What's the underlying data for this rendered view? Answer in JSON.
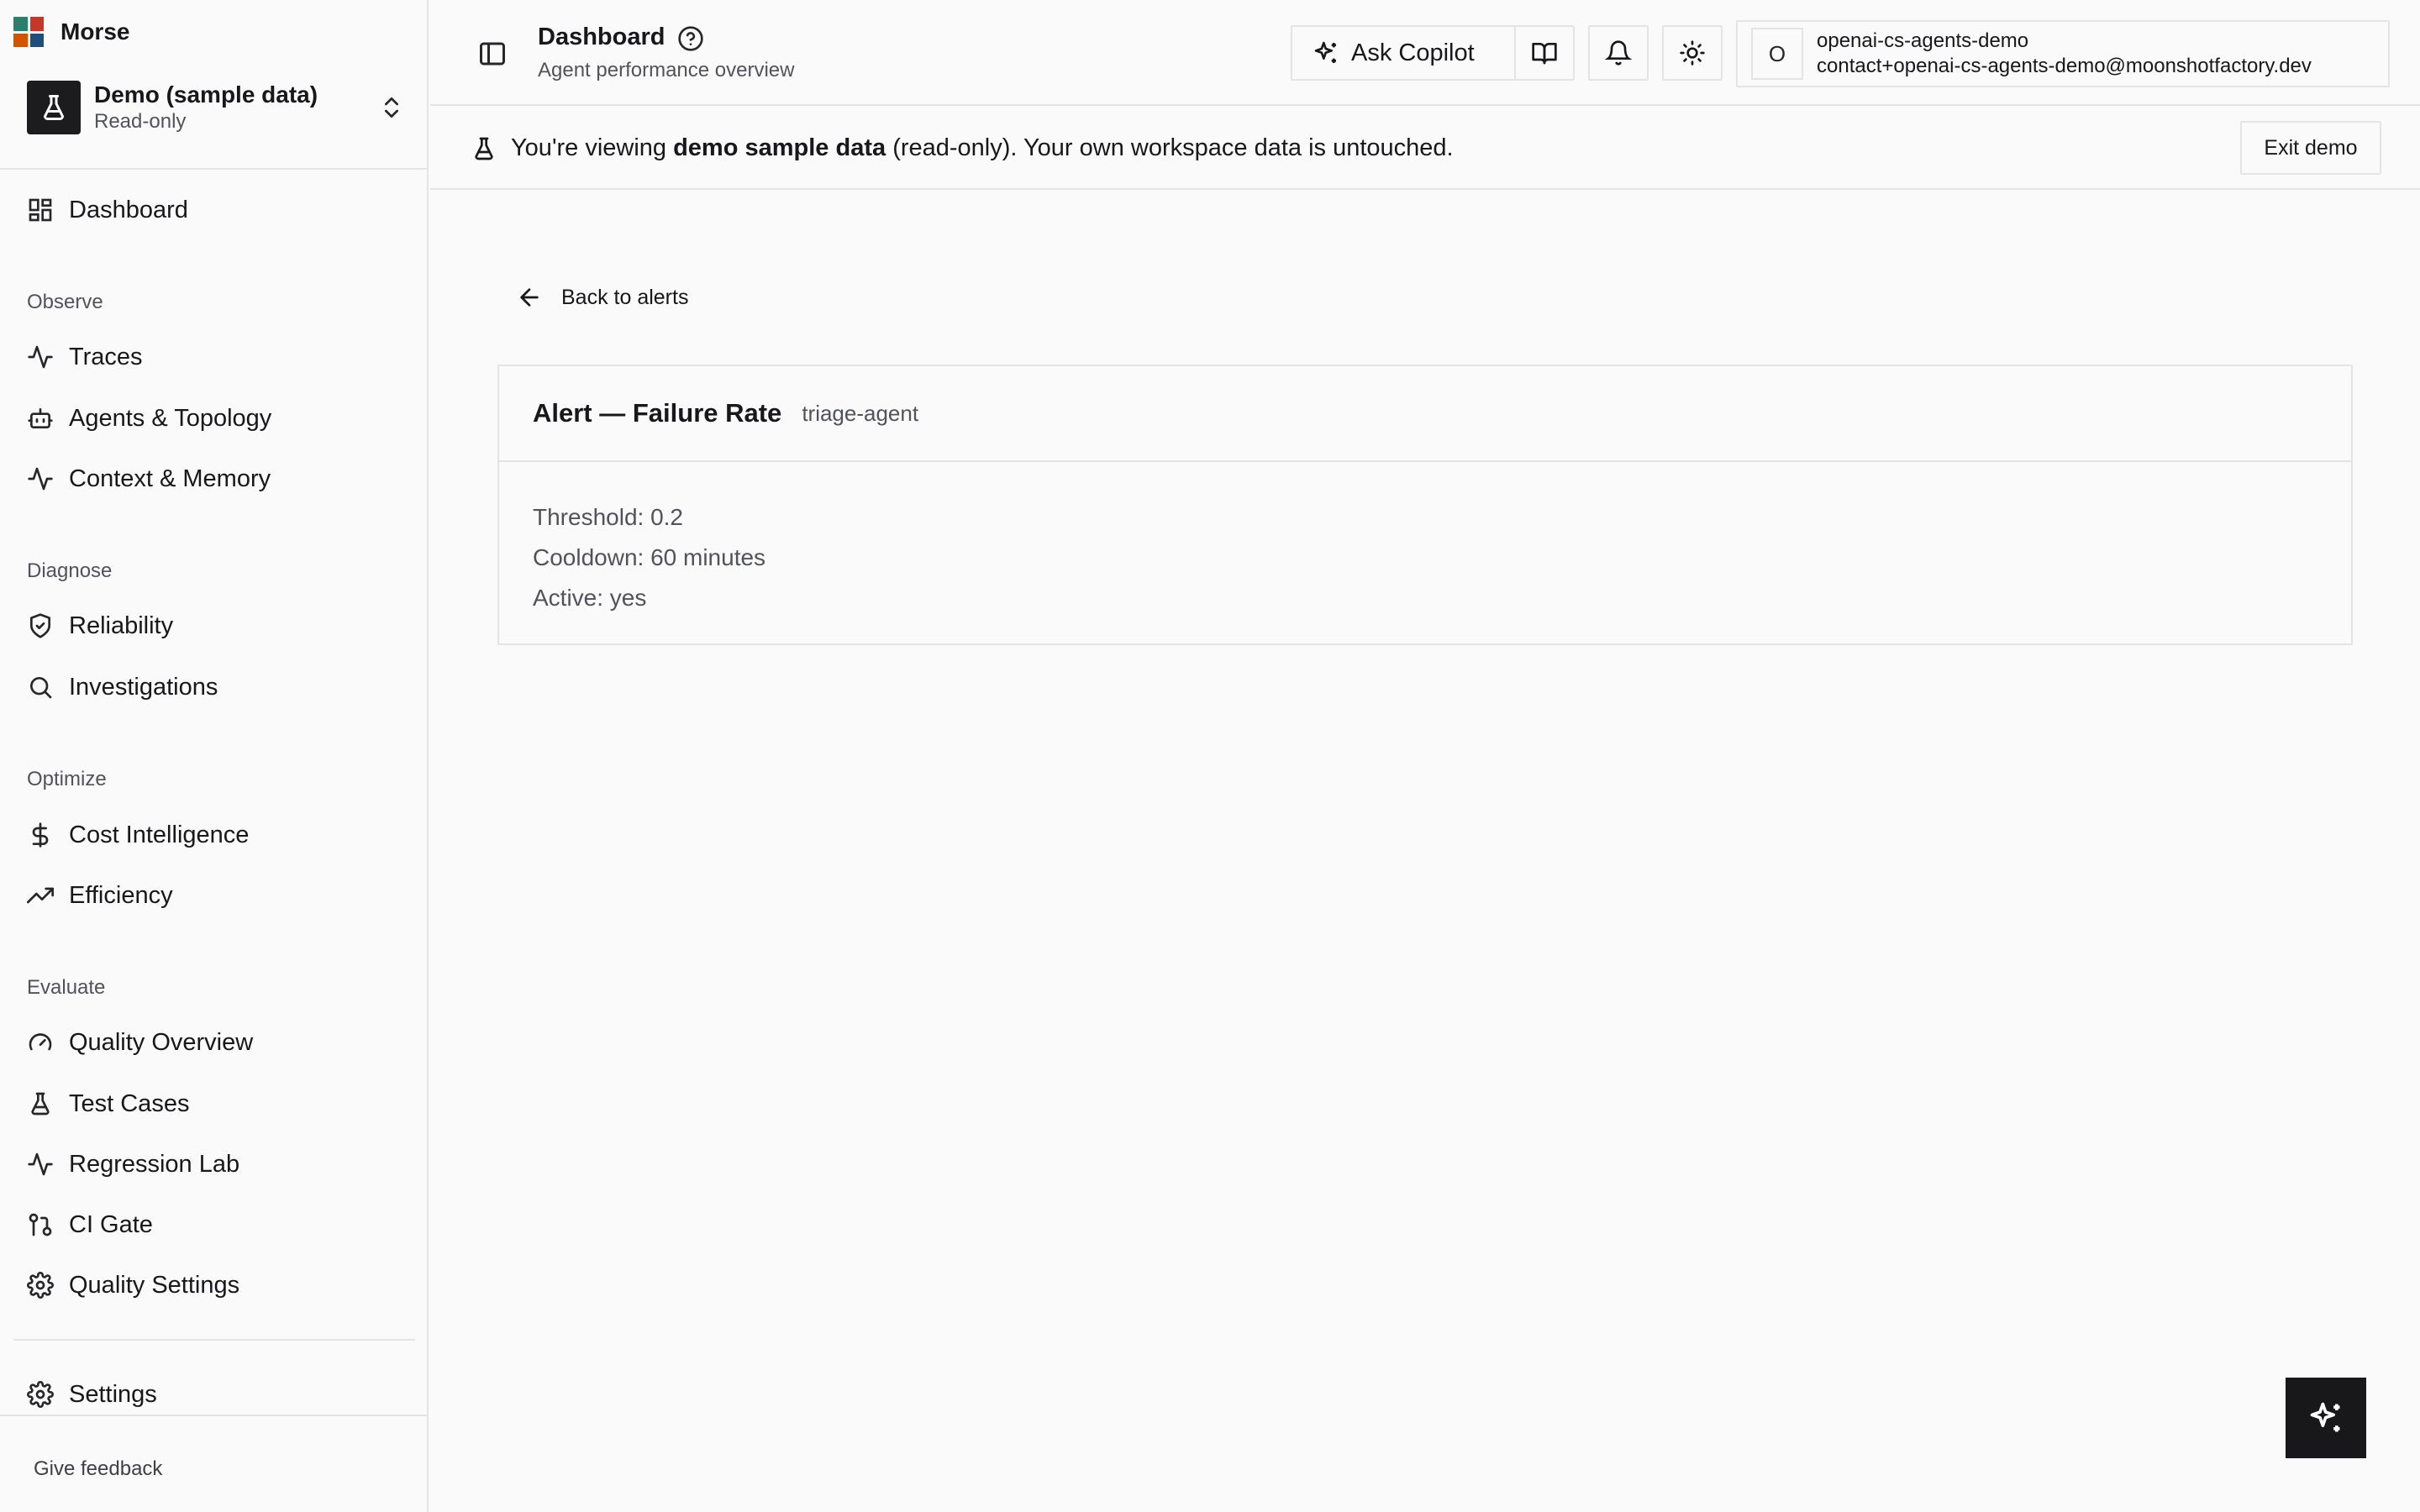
{
  "brand": {
    "name": "Morse",
    "logo_colors": [
      "#2f7d6d",
      "#c0392b",
      "#d35400",
      "#1f4e79"
    ]
  },
  "workspace": {
    "name": "Demo (sample data)",
    "access": "Read-only",
    "icon": "flask-icon"
  },
  "sidebar": {
    "top_item": {
      "label": "Dashboard",
      "icon": "dashboard-icon"
    },
    "sections": [
      {
        "title": "Observe",
        "items": [
          {
            "label": "Traces",
            "icon": "activity-icon"
          },
          {
            "label": "Agents & Topology",
            "icon": "bot-icon"
          },
          {
            "label": "Context & Memory",
            "icon": "activity-icon"
          }
        ]
      },
      {
        "title": "Diagnose",
        "items": [
          {
            "label": "Reliability",
            "icon": "shield-check-icon"
          },
          {
            "label": "Investigations",
            "icon": "search-icon"
          }
        ]
      },
      {
        "title": "Optimize",
        "items": [
          {
            "label": "Cost Intelligence",
            "icon": "dollar-icon"
          },
          {
            "label": "Efficiency",
            "icon": "trending-up-icon"
          }
        ]
      },
      {
        "title": "Evaluate",
        "items": [
          {
            "label": "Quality Overview",
            "icon": "gauge-icon"
          },
          {
            "label": "Test Cases",
            "icon": "flask-icon"
          },
          {
            "label": "Regression Lab",
            "icon": "activity-icon"
          },
          {
            "label": "CI Gate",
            "icon": "git-pull-request-icon"
          },
          {
            "label": "Quality Settings",
            "icon": "gear-icon"
          }
        ]
      }
    ],
    "settings": {
      "label": "Settings",
      "icon": "gear-icon"
    },
    "feedback": "Give feedback"
  },
  "header": {
    "title": "Dashboard",
    "subtitle": "Agent performance overview",
    "copilot_label": "Ask Copilot",
    "user": {
      "initial": "O",
      "name": "openai-cs-agents-demo",
      "email": "contact+openai-cs-agents-demo@moonshotfactory.dev"
    }
  },
  "banner": {
    "prefix": "You're viewing",
    "bold": "demo sample data",
    "suffix": "(read-only). Your own workspace data is untouched.",
    "exit_label": "Exit demo"
  },
  "main": {
    "back_label": "Back to alerts",
    "alert": {
      "title": "Alert — Failure Rate",
      "agent": "triage-agent",
      "lines": [
        "Threshold: 0.2",
        "Cooldown: 60 minutes",
        "Active: yes"
      ]
    }
  },
  "colors": {
    "accent_dark": "#18181b",
    "border": "#e4e4e7",
    "muted_text": "#52525b",
    "background": "#fafafa"
  }
}
